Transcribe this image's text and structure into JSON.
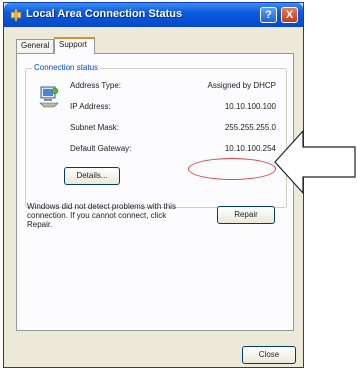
{
  "window": {
    "title": "Local Area Connection Status",
    "help_label": "?",
    "close_label": "X"
  },
  "tabs": [
    {
      "label": "General",
      "selected": false
    },
    {
      "label": "Support",
      "selected": true
    }
  ],
  "connection_status": {
    "group_title": "Connection status",
    "rows": [
      {
        "label": "Address Type:",
        "value": "Assigned by DHCP"
      },
      {
        "label": "IP Address:",
        "value": "10.10.100.100"
      },
      {
        "label": "Subnet Mask:",
        "value": "255.255.255.0"
      },
      {
        "label": "Default Gateway:",
        "value": "10.10.100.254"
      }
    ],
    "details_button": "Details..."
  },
  "repair": {
    "message": "Windows did not detect problems with this\nconnection. If you cannot connect, click\nRepair.",
    "button": "Repair"
  },
  "footer": {
    "close_button": "Close"
  },
  "colors": {
    "titlebar": "#0a5be0",
    "group_title": "#0046d5",
    "highlight": "#e23d3d",
    "dialog_bg": "#ece9d8"
  }
}
